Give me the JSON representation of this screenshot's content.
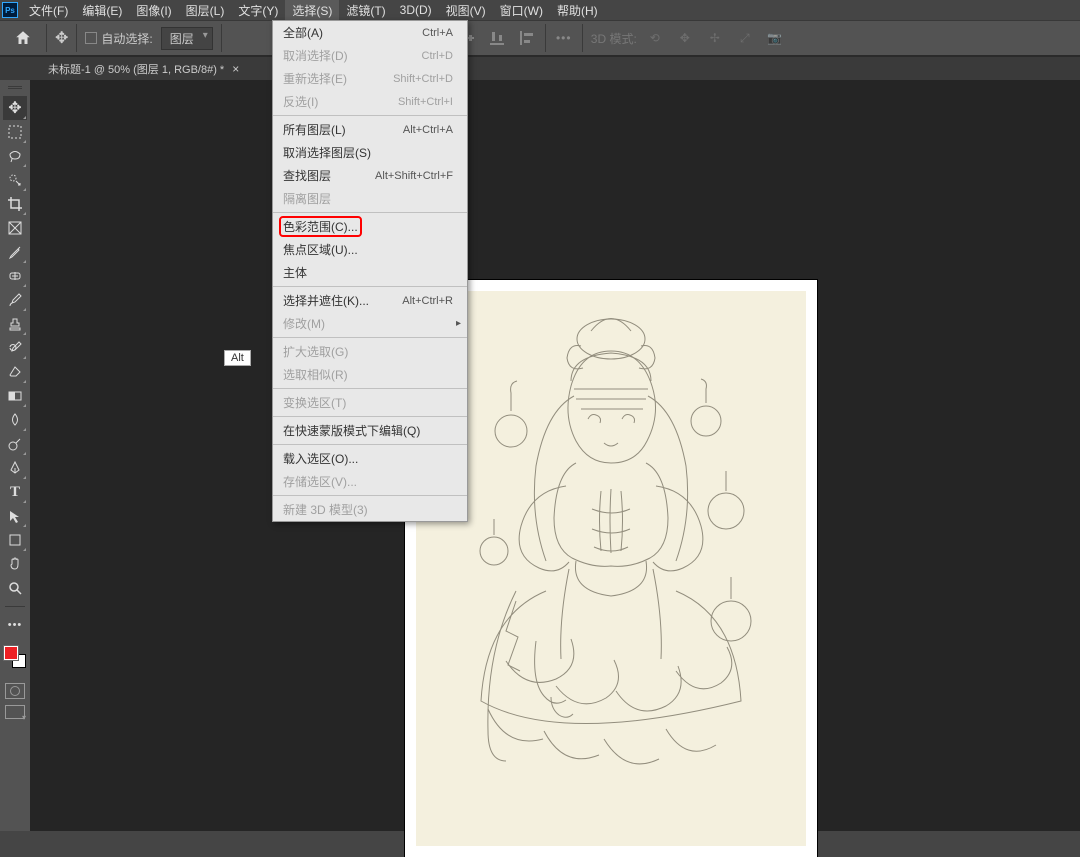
{
  "app": {
    "logo_text": "Ps"
  },
  "menubar": {
    "items": [
      {
        "label": "文件(F)"
      },
      {
        "label": "编辑(E)"
      },
      {
        "label": "图像(I)"
      },
      {
        "label": "图层(L)"
      },
      {
        "label": "文字(Y)"
      },
      {
        "label": "选择(S)",
        "open": true
      },
      {
        "label": "滤镜(T)"
      },
      {
        "label": "3D(D)"
      },
      {
        "label": "视图(V)"
      },
      {
        "label": "窗口(W)"
      },
      {
        "label": "帮助(H)"
      }
    ]
  },
  "options": {
    "auto_select": "自动选择:",
    "layer_dd": "图层",
    "mode_3d": "3D 模式:"
  },
  "doc_tab": {
    "title": "未标题-1 @ 50% (图层 1, RGB/8#) *",
    "close": "×"
  },
  "alt_tooltip": "Alt",
  "dropdown": {
    "groups": [
      [
        {
          "label": "全部(A)",
          "shortcut": "Ctrl+A"
        },
        {
          "label": "取消选择(D)",
          "shortcut": "Ctrl+D",
          "disabled": true
        },
        {
          "label": "重新选择(E)",
          "shortcut": "Shift+Ctrl+D",
          "disabled": true
        },
        {
          "label": "反选(I)",
          "shortcut": "Shift+Ctrl+I",
          "disabled": true
        }
      ],
      [
        {
          "label": "所有图层(L)",
          "shortcut": "Alt+Ctrl+A"
        },
        {
          "label": "取消选择图层(S)"
        },
        {
          "label": "查找图层",
          "shortcut": "Alt+Shift+Ctrl+F"
        },
        {
          "label": "隔离图层",
          "disabled": true
        }
      ],
      [
        {
          "label": "色彩范围(C)...",
          "highlight": true
        },
        {
          "label": "焦点区域(U)..."
        },
        {
          "label": "主体"
        }
      ],
      [
        {
          "label": "选择并遮住(K)...",
          "shortcut": "Alt+Ctrl+R"
        },
        {
          "label": "修改(M)",
          "disabled": true,
          "submenu": true
        }
      ],
      [
        {
          "label": "扩大选取(G)",
          "disabled": true
        },
        {
          "label": "选取相似(R)",
          "disabled": true
        }
      ],
      [
        {
          "label": "变换选区(T)",
          "disabled": true
        }
      ],
      [
        {
          "label": "在快速蒙版模式下编辑(Q)"
        }
      ],
      [
        {
          "label": "载入选区(O)..."
        },
        {
          "label": "存储选区(V)...",
          "disabled": true
        }
      ],
      [
        {
          "label": "新建 3D 模型(3)",
          "disabled": true
        }
      ]
    ]
  }
}
